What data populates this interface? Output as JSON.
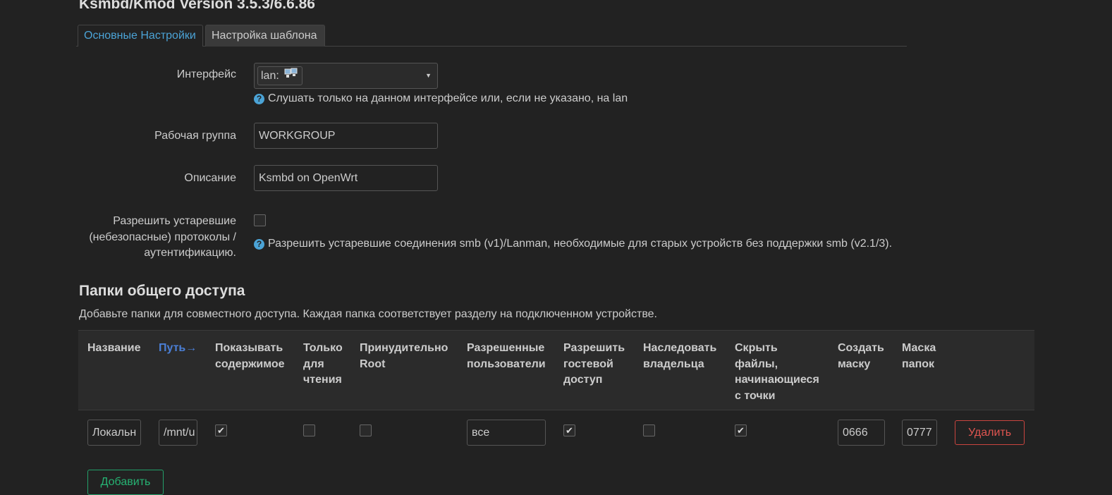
{
  "page": {
    "title": "Ksmbd/Kmod Version 3.5.3/6.6.86"
  },
  "tabs": [
    {
      "label": "Основные Настройки",
      "active": true
    },
    {
      "label": "Настройка шаблона",
      "active": false
    }
  ],
  "form": {
    "interface": {
      "label": "Интерфейс",
      "value": "lan:",
      "help": "Слушать только на данном интерфейсе или, если не указано, на lan"
    },
    "workgroup": {
      "label": "Рабочая группа",
      "value": "WORKGROUP"
    },
    "description": {
      "label": "Описание",
      "value": "Ksmbd on OpenWrt"
    },
    "legacy": {
      "label_line1": "Разрешить устаревшие",
      "label_line2": "(небезопасные) протоколы /",
      "label_line3": "аутентификацию.",
      "checked": false,
      "help": "Разрешить устаревшие соединения smb (v1)/Lanman, необходимые для старых устройств без поддержки smb (v2.1/3)."
    }
  },
  "shares": {
    "title": "Папки общего доступа",
    "description": "Добавьте папки для совместного доступа. Каждая папка соответствует разделу на подключенном устройстве.",
    "columns": {
      "name": "Название",
      "path": "Путь",
      "path_sort_indicator": "→",
      "browseable": [
        "Показывать",
        "содержимое"
      ],
      "readonly": [
        "Только",
        "для",
        "чтения"
      ],
      "force_root": [
        "Принудительно",
        "Root"
      ],
      "users": [
        "Разрешенные",
        "пользователи"
      ],
      "guest": [
        "Разрешить",
        "гостевой",
        "доступ"
      ],
      "inherit": [
        "Наследовать",
        "владельца"
      ],
      "hide_dot": [
        "Скрыть",
        "файлы,",
        "начинающиеся",
        "с точки"
      ],
      "create_mask": [
        "Создать",
        "маску"
      ],
      "dir_mask": [
        "Маска",
        "папок"
      ]
    },
    "rows": [
      {
        "name": "Локальн",
        "path": "/mnt/u",
        "browseable": true,
        "readonly": false,
        "force_root": false,
        "users": "все",
        "guest": true,
        "inherit": false,
        "hide_dot": true,
        "create_mask": "0666",
        "dir_mask": "0777",
        "delete_label": "Удалить"
      }
    ],
    "add_label": "Добавить"
  },
  "colors": {
    "background": "#222222",
    "accent_blue": "#4ba3d6",
    "sort_blue": "#4b7fd6",
    "danger": "#e05550",
    "success": "#26b373"
  }
}
